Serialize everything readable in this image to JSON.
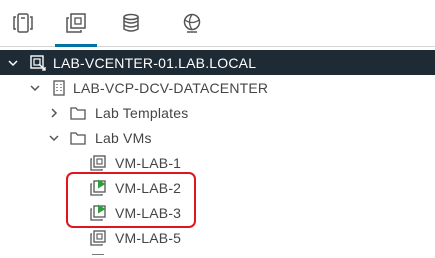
{
  "tabs": [
    {
      "icon": "hosts-and-clusters-icon"
    },
    {
      "icon": "vms-and-templates-icon",
      "active": true
    },
    {
      "icon": "storage-icon"
    },
    {
      "icon": "networking-icon"
    }
  ],
  "tree": {
    "vcenter": {
      "label": "LAB-VCENTER-01.LAB.LOCAL",
      "icon": "vcenter-icon"
    },
    "datacenter": {
      "label": "LAB-VCP-DCV-DATACENTER",
      "icon": "datacenter-icon"
    },
    "lab_templates": {
      "label": "Lab Templates",
      "icon": "folder-icon"
    },
    "lab_vms": {
      "label": "Lab VMs",
      "icon": "folder-icon"
    },
    "vms": [
      {
        "label": "VM-LAB-1",
        "state": "powered-off"
      },
      {
        "label": "VM-LAB-2",
        "state": "powered-on"
      },
      {
        "label": "VM-LAB-3",
        "state": "powered-on"
      },
      {
        "label": "VM-LAB-5",
        "state": "powered-off"
      }
    ]
  },
  "colors": {
    "selected_row": "#1e2b34",
    "highlight_border": "#e0151e",
    "active_tab": "#0072a3",
    "power_on_green": "#2e9e3e"
  }
}
